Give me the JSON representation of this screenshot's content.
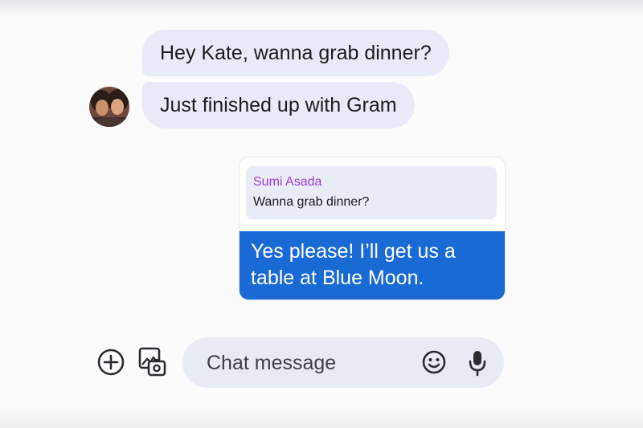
{
  "conversation": {
    "incoming": [
      {
        "text": "Hey Kate, wanna grab dinner?"
      },
      {
        "text": "Just finished up with Gram"
      }
    ],
    "reply": {
      "quoted_sender": "Sumi Asada",
      "quoted_text": "Wanna grab dinner?",
      "text": "Yes please! I’ll get us a table at Blue Moon."
    }
  },
  "composer": {
    "placeholder": "Chat message",
    "icons": [
      "add-icon",
      "gallery-icon",
      "emoji-icon",
      "microphone-icon"
    ]
  },
  "colors": {
    "incoming_bubble": "#e8ebf7",
    "outgoing_bubble": "#1a6ad6",
    "quote_sender": "#9c3fd0",
    "composer_bg": "#e9ebf4"
  }
}
